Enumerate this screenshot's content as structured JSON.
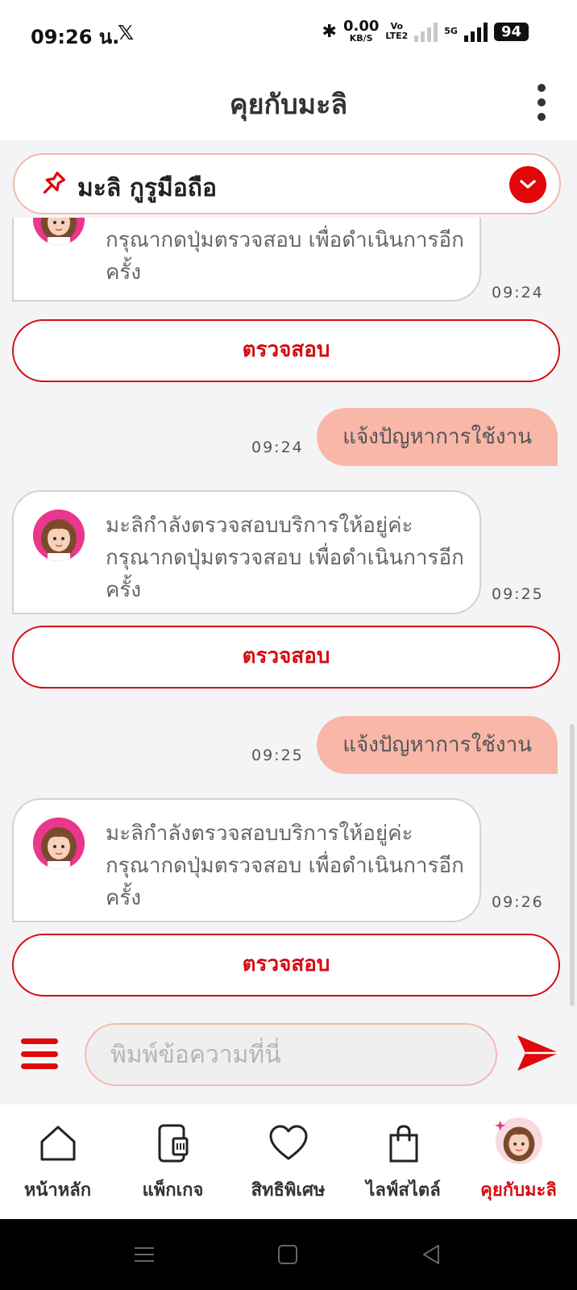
{
  "status_bar": {
    "time": "09:26 น.",
    "x_logo": "𝕏",
    "bluetooth": "✱",
    "net_speed": "0.00",
    "net_unit": "KB/S",
    "vo_lte": "Vo",
    "lte_label": "LTE2",
    "signal_5g": "5G",
    "battery": "94"
  },
  "header": {
    "title": "คุยกับมะลิ"
  },
  "pinned": {
    "title": "มะลิ กูรูมือถือ"
  },
  "chat": {
    "messages": [
      {
        "type": "bot",
        "text": "กรุณากดปุ่มตรวจสอบ เพื่อดำเนินการอีกครั้ง",
        "time": "09:24"
      },
      {
        "type": "button",
        "label": "ตรวจสอบ"
      },
      {
        "type": "user",
        "text": "แจ้งปัญหาการใช้งาน",
        "time": "09:24"
      },
      {
        "type": "bot",
        "text": "มะลิกำลังตรวจสอบบริการให้อยู่ค่ะ กรุณากดปุ่มตรวจสอบ เพื่อดำเนินการอีกครั้ง",
        "time": "09:25"
      },
      {
        "type": "button",
        "label": "ตรวจสอบ"
      },
      {
        "type": "user",
        "text": "แจ้งปัญหาการใช้งาน",
        "time": "09:25"
      },
      {
        "type": "bot",
        "text": "มะลิกำลังตรวจสอบบริการให้อยู่ค่ะ กรุณากดปุ่มตรวจสอบ เพื่อดำเนินการอีกครั้ง",
        "time": "09:26"
      },
      {
        "type": "button",
        "label": "ตรวจสอบ"
      }
    ]
  },
  "input": {
    "placeholder": "พิมพ์ข้อความที่นี่",
    "value": ""
  },
  "nav": {
    "items": [
      {
        "label": "หน้าหลัก",
        "icon": "home-icon"
      },
      {
        "label": "แพ็กเกจ",
        "icon": "phone-sim-icon"
      },
      {
        "label": "สิทธิพิเศษ",
        "icon": "heart-icon"
      },
      {
        "label": "ไลฟ์สไตล์",
        "icon": "shopping-bag-icon"
      },
      {
        "label": "คุยกับมะลิ",
        "icon": "mali-avatar-icon",
        "active": true
      }
    ]
  },
  "colors": {
    "accent_red": "#e1070a",
    "user_bubble": "#f9b7a8",
    "pinned_border": "#f2b8ae"
  }
}
